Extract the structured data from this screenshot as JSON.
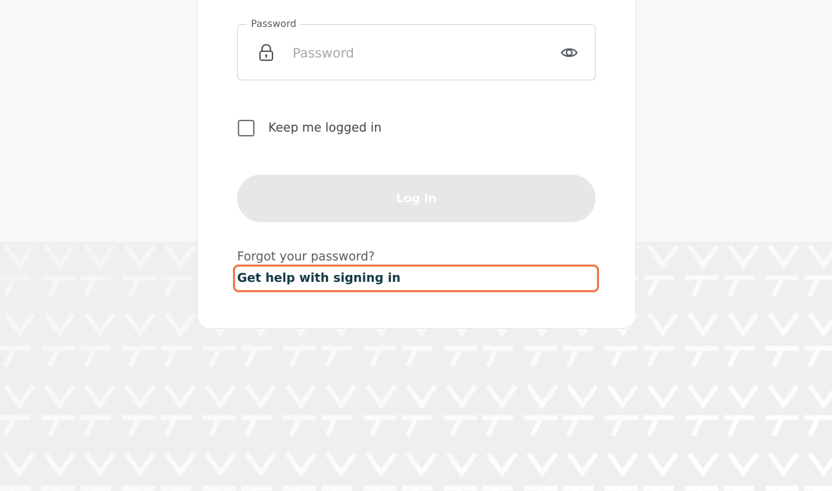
{
  "password_field": {
    "label": "Password",
    "placeholder": "Password",
    "value": "",
    "lock_icon": "lock-icon",
    "visibility_icon": "eye-icon"
  },
  "remember": {
    "label": "Keep me logged in",
    "checked": false
  },
  "login_button": {
    "label": "Log in",
    "enabled": false
  },
  "links": {
    "forgot_password": "Forgot your password?",
    "get_help": "Get help with signing in"
  },
  "colors": {
    "page_background": "#f7f8f8",
    "pattern_background": "#eeeff0",
    "button_disabled": "#e6e7e8",
    "help_link": "#143b45",
    "highlight": "#ee7a47"
  }
}
